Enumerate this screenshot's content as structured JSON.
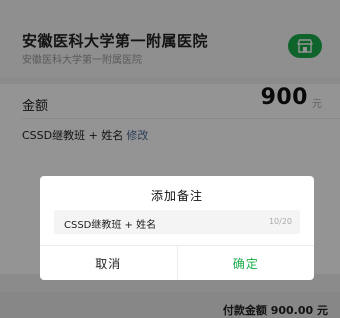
{
  "merchant": {
    "name": "安徽医科大学第一附属医院",
    "subtitle": "安徽医科大学第一附属医院",
    "badge_icon": "store-icon",
    "badge_color": "#1aad4b"
  },
  "payment": {
    "amount_label": "金额",
    "amount_value": "900",
    "amount_unit": "元",
    "remark_text": "CSSD继教班 + 姓名",
    "remark_edit_label": "修改"
  },
  "dialog": {
    "title": "添加备注",
    "input_value": "CSSD继教班 + 姓名",
    "char_counter": "10/20",
    "cancel_label": "取消",
    "confirm_label": "确定"
  },
  "footer": {
    "pay_total": "付款金额 900.00 元"
  }
}
